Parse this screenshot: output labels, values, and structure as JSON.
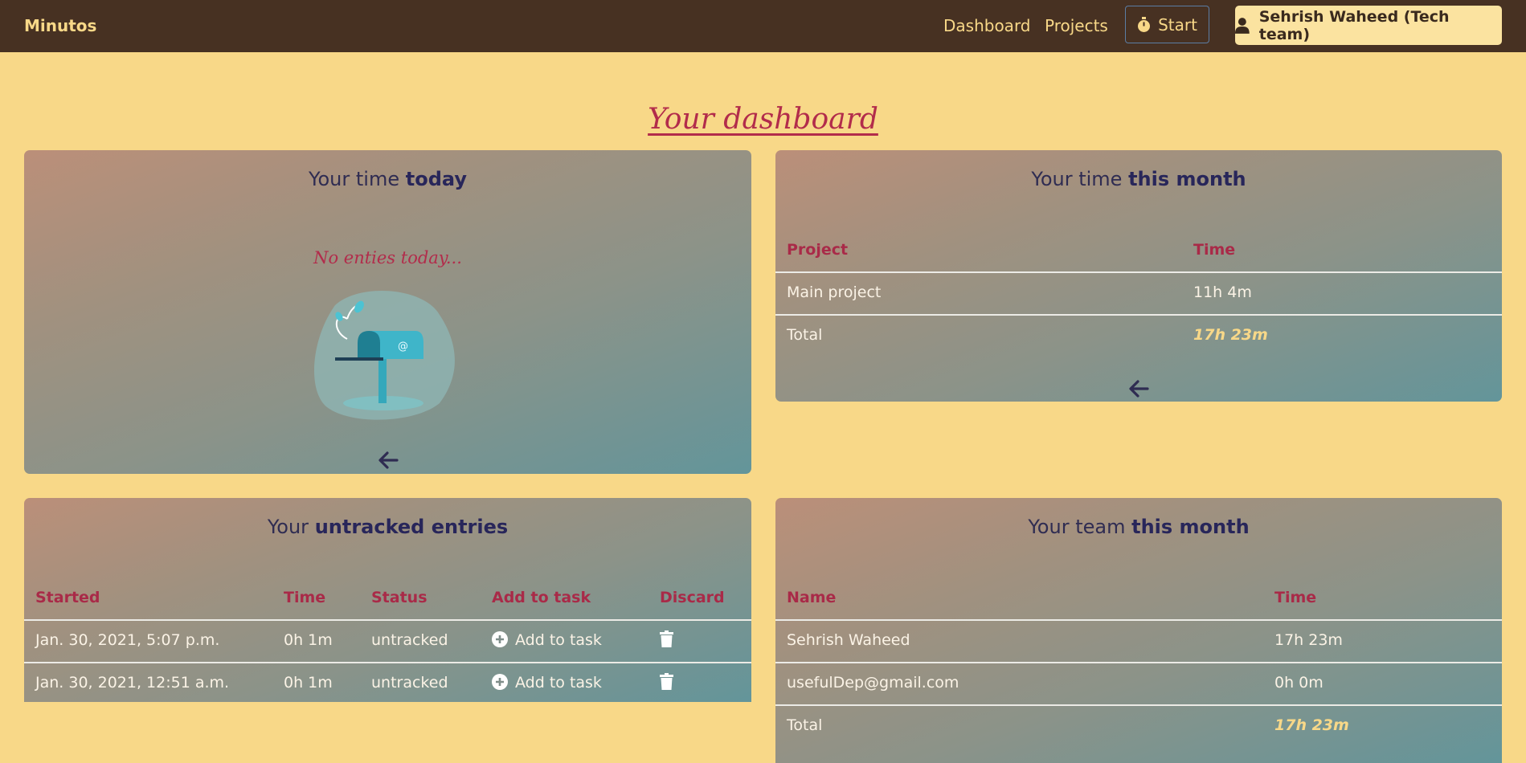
{
  "nav": {
    "brand": "Minutos",
    "dashboard": "Dashboard",
    "projects": "Projects",
    "start": "Start",
    "user": "Sehrish Waheed (Tech team)"
  },
  "page": {
    "title": "Your dashboard"
  },
  "today": {
    "title_prefix": "Your time ",
    "title_bold": "today",
    "empty_message": "No enties today..."
  },
  "month": {
    "title_prefix": "Your time ",
    "title_bold": "this month",
    "headers": {
      "project": "Project",
      "time": "Time"
    },
    "rows": [
      {
        "project": "Main project",
        "time": "11h 4m"
      }
    ],
    "total_label": "Total",
    "total_value": "17h 23m"
  },
  "untracked": {
    "title_prefix": "Your ",
    "title_bold": "untracked entries",
    "headers": {
      "started": "Started",
      "time": "Time",
      "status": "Status",
      "add": "Add to task",
      "discard": "Discard"
    },
    "rows": [
      {
        "started": "Jan. 30, 2021, 5:07 p.m.",
        "time": "0h 1m",
        "status": "untracked",
        "add": "Add to task"
      },
      {
        "started": "Jan. 30, 2021, 12:51 a.m.",
        "time": "0h 1m",
        "status": "untracked",
        "add": "Add to task"
      }
    ]
  },
  "team": {
    "title_prefix": "Your team ",
    "title_bold": "this month",
    "headers": {
      "name": "Name",
      "time": "Time"
    },
    "rows": [
      {
        "name": "Sehrish Waheed",
        "time": "17h 23m"
      },
      {
        "name": "usefulDep@gmail.com",
        "time": "0h 0m"
      }
    ],
    "total_label": "Total",
    "total_value": "17h 23m"
  },
  "colors": {
    "navbar": "#473122",
    "page_bg": "#f8d888",
    "accent_red": "#b22c4b",
    "title_navy": "#2f2c52",
    "total_gold": "#f8d888"
  },
  "icons": [
    "stopwatch-icon",
    "user-icon",
    "back-arrow-icon",
    "mailbox-illustration",
    "plus-circle-icon",
    "trash-icon"
  ]
}
